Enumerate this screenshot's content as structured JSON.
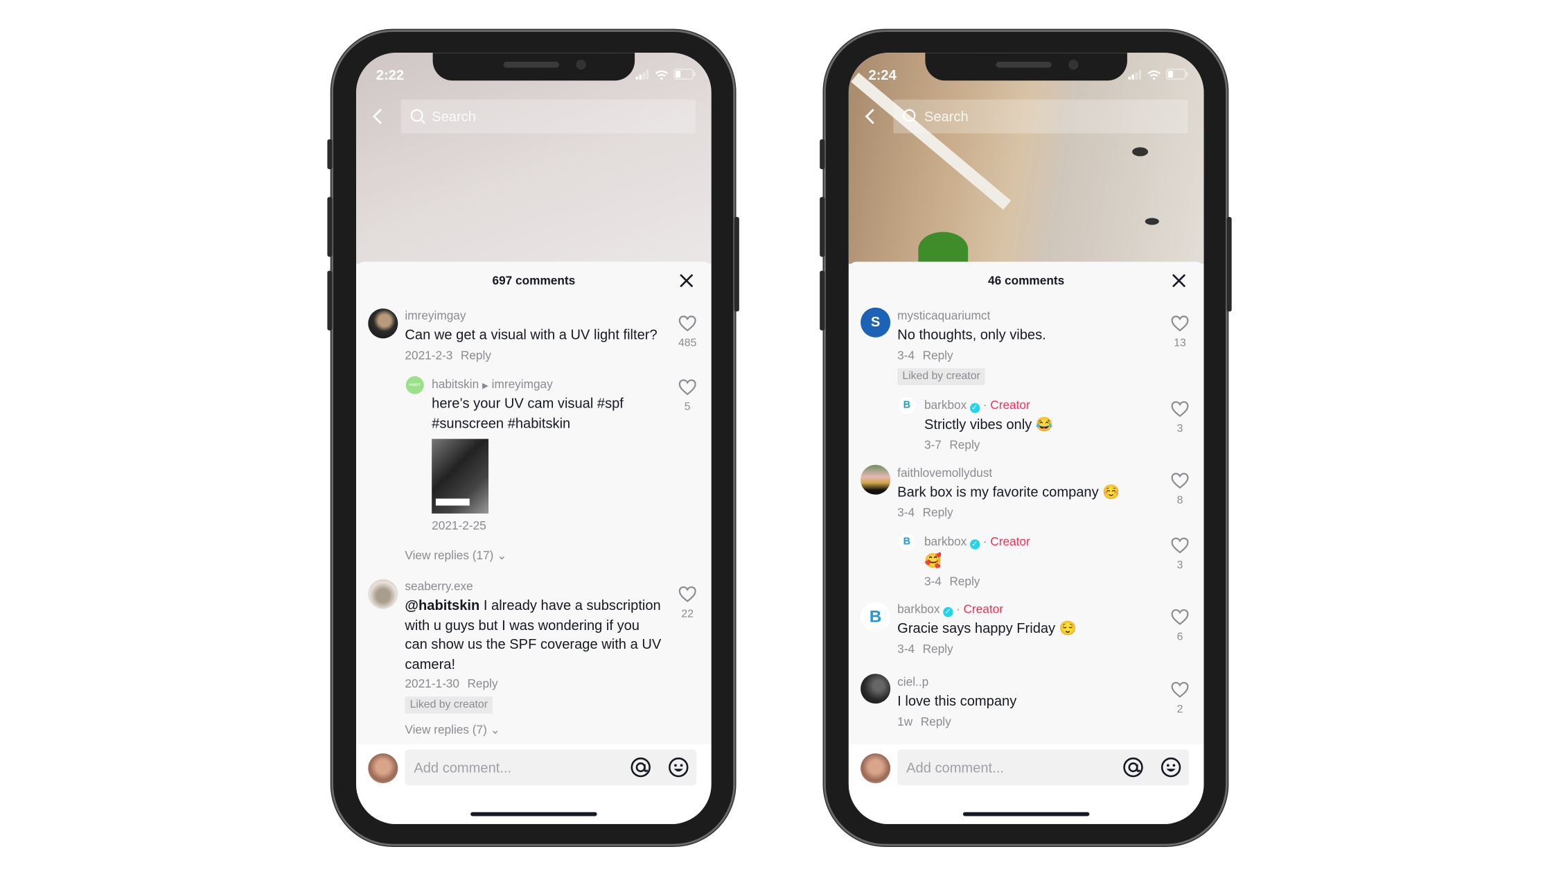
{
  "left": {
    "status_time": "2:22",
    "search_placeholder": "Search",
    "comments_count_label": "697 comments",
    "comments": [
      {
        "username": "imreyimgay",
        "text": "Can we get a visual with a UV light filter?",
        "date": "2021-2-3",
        "reply": "Reply",
        "likes": "485"
      },
      {
        "username": "habitskin",
        "reply_to": "imreyimgay",
        "text": "here’s your UV cam visual #spf #sunscreen #habitskin",
        "date": "2021-2-25",
        "likes": "5",
        "avatar_text": "HABIT"
      },
      {
        "username": "seaberry.exe",
        "mention": "@habitskin",
        "text": " I already have a subscription with u guys but I was wondering if you can show us the SPF coverage with a UV camera!",
        "date": "2021-1-30",
        "reply": "Reply",
        "liked_badge": "Liked by creator",
        "likes": "22"
      }
    ],
    "view_replies": [
      "View replies (17)",
      "View replies (7)"
    ],
    "input_placeholder": "Add comment..."
  },
  "right": {
    "status_time": "2:24",
    "search_placeholder": "Search",
    "comments_count_label": "46 comments",
    "comments": [
      {
        "username": "mysticaquariumct",
        "text": "No thoughts, only vibes.",
        "date": "3-4",
        "reply": "Reply",
        "liked_badge": "Liked by creator",
        "likes": "13"
      },
      {
        "username": "barkbox",
        "creator_label": "Creator",
        "text": "Strictly vibes only 😂",
        "date": "3-7",
        "reply": "Reply",
        "likes": "3"
      },
      {
        "username": "faithlovemollydust",
        "text": "Bark box is my favorite company ☺️",
        "date": "3-4",
        "reply": "Reply",
        "likes": "8"
      },
      {
        "username": "barkbox",
        "creator_label": "Creator",
        "text": "🥰",
        "date": "3-4",
        "reply": "Reply",
        "likes": "3"
      },
      {
        "username": "barkbox",
        "creator_label": "Creator",
        "text": "Gracie says happy Friday 😌",
        "date": "3-4",
        "reply": "Reply",
        "likes": "6"
      },
      {
        "username": "ciel..p",
        "text": "I love this company",
        "date": "1w",
        "reply": "Reply",
        "likes": "2"
      }
    ],
    "input_placeholder": "Add comment..."
  },
  "colors": {
    "creator": "#fe2c55",
    "verified": "#20d5ec",
    "accent_dark": "#161823"
  }
}
